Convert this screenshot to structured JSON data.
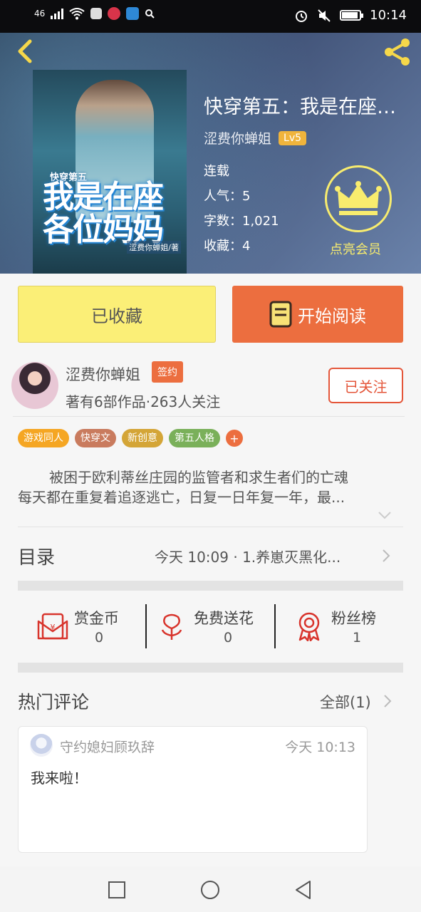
{
  "status_bar": {
    "network": "46",
    "time": "10:14",
    "icons": [
      "signal-icon",
      "wifi-icon",
      "app-icon",
      "app-icon",
      "app-icon",
      "search-icon",
      "alarm-icon",
      "mute-icon",
      "battery-icon"
    ]
  },
  "book": {
    "title": "快穿第五：我是在座各位妈妈",
    "author": "涩费你蝉姐",
    "level": "Lv5",
    "status": "连载",
    "popularity": "人气：5",
    "word_count": "字数：1,021",
    "favorites": "收藏：4",
    "vip_label": "点亮会员",
    "cover": {
      "series": "快穿第五",
      "title": "我是在座各位妈妈",
      "author": "涩费你蝉姐/著"
    }
  },
  "actions": {
    "collected": "已收藏",
    "start_reading": "开始阅读"
  },
  "author": {
    "name": "涩费你蝉姐",
    "sign_badge": "签约",
    "stats": "著有6部作品·263人关注",
    "follow": "已关注"
  },
  "tags": [
    {
      "label": "游戏同人",
      "color": "#f5a623"
    },
    {
      "label": "快穿文",
      "color": "#c97b5e"
    },
    {
      "label": "新创意",
      "color": "#d4a537"
    },
    {
      "label": "第五人格",
      "color": "#7ab05a"
    }
  ],
  "tag_more": "+",
  "synopsis": {
    "line1": "被困于欧利蒂丝庄园的监管者和求生者们的亡魂",
    "line2": "每天都在重复着追逐逃亡，日复一日年复一年，最..."
  },
  "toc": {
    "title": "目录",
    "latest": "今天 10:09 · 1.养崽灭黑化..."
  },
  "rewards": [
    {
      "label": "赏金币",
      "count": "0"
    },
    {
      "label": "免费送花",
      "count": "0"
    },
    {
      "label": "粉丝榜",
      "count": "1"
    }
  ],
  "comments": {
    "title": "热门评论",
    "all": "全部(1)",
    "items": [
      {
        "user": "守约媳妇顾玖辞",
        "time": "今天 10:13",
        "text": "我来啦！"
      }
    ]
  },
  "colors": {
    "accent": "#ec6e3f",
    "collected_bg": "#fbef77",
    "vip_gold": "#f8ec6e",
    "level_badge": "#f0b43c"
  }
}
